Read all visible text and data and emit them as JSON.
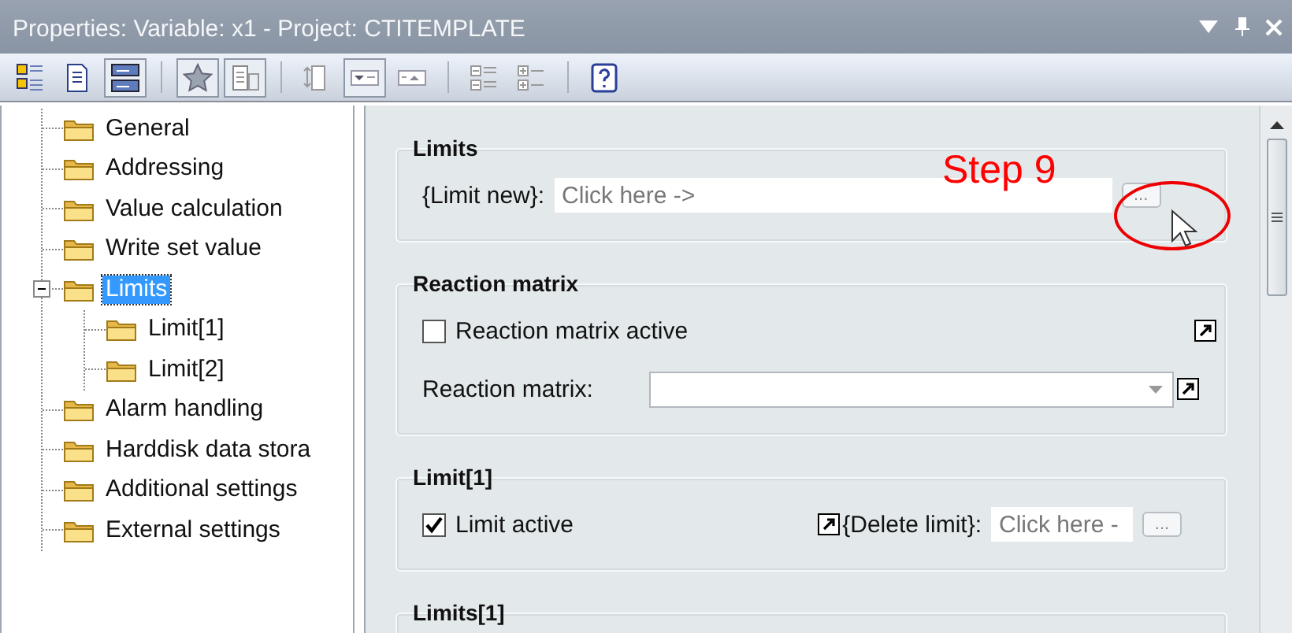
{
  "window": {
    "title": "Properties: Variable: x1 - Project: CTITEMPLATE"
  },
  "title_buttons": [
    {
      "kind": "menu"
    },
    {
      "kind": "pin"
    },
    {
      "kind": "close"
    }
  ],
  "toolbar": [
    [
      {
        "kind": "categorized",
        "pressed": false
      },
      {
        "kind": "document",
        "pressed": false
      },
      {
        "kind": "panels",
        "pressed": true
      }
    ],
    [
      {
        "kind": "favorites",
        "pressed": true
      },
      {
        "kind": "docgrid",
        "pressed": true
      }
    ],
    [
      {
        "kind": "sortdoc",
        "pressed": false
      },
      {
        "kind": "collapse",
        "pressed": true
      },
      {
        "kind": "expand",
        "pressed": false
      }
    ],
    [
      {
        "kind": "collapseall",
        "pressed": false
      },
      {
        "kind": "expandall",
        "pressed": false
      }
    ],
    [
      {
        "kind": "help",
        "pressed": false
      }
    ]
  ],
  "tree": [
    {
      "label": "General",
      "selected": false
    },
    {
      "label": "Addressing",
      "selected": false
    },
    {
      "label": "Value calculation",
      "selected": false
    },
    {
      "label": "Write set value",
      "selected": false
    },
    {
      "label": "Limits",
      "selected": true,
      "expanded": true,
      "children": [
        {
          "label": "Limit[1]",
          "selected": false
        },
        {
          "label": "Limit[2]",
          "selected": false
        }
      ]
    },
    {
      "label": "Alarm handling",
      "selected": false
    },
    {
      "label": "Harddisk data stora",
      "selected": false
    },
    {
      "label": "Additional settings",
      "selected": false
    },
    {
      "label": "External settings",
      "selected": false
    }
  ],
  "sections": [
    {
      "title": "Limits",
      "rows": [
        {
          "kind": "field",
          "label": "{Limit new}:",
          "value": "Click here ->",
          "button": "..."
        }
      ]
    },
    {
      "title": "Reaction matrix",
      "rows": [
        {
          "kind": "checkbox",
          "label": "Reaction matrix active",
          "checked": false,
          "link": true
        },
        {
          "kind": "combo",
          "label": "Reaction matrix:",
          "link": true
        }
      ]
    },
    {
      "title": "Limit[1]",
      "rows": [
        {
          "kind": "checkbox_field",
          "label": "Limit active",
          "checked": true,
          "link": true,
          "field_label": "{Delete limit}:",
          "value": "Click here -",
          "button": "..."
        }
      ]
    },
    {
      "title": "Limits[1]"
    }
  ],
  "annotation": {
    "text": "Step 9"
  }
}
